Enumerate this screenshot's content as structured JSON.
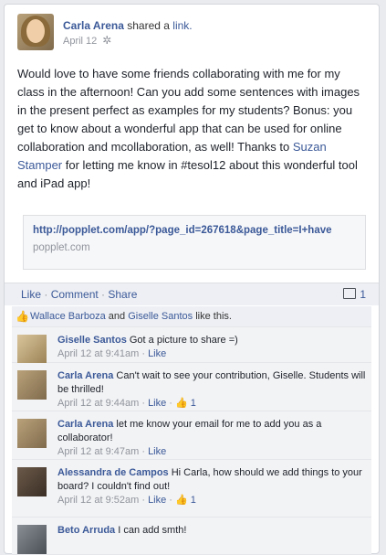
{
  "post": {
    "author": "Carla Arena",
    "action": " shared a ",
    "action_link": "link.",
    "date": "April 12",
    "body_part1": "Would love to have some friends collaborating with me for my class in the afternoon! Can you add some sentences with images in the present perfect as examples for my students? Bonus: you get to know about a wonderful app that can be used for online collaboration and mcollaboration, as well! Thanks to ",
    "body_mention": "Suzan Stamper",
    "body_part2": " for letting me know in #tesol12 about this wonderful tool and iPad app!",
    "link_url": "http://popplet.com/app/?page_id=267618&page_title=I+have",
    "link_domain": "popplet.com"
  },
  "actions": {
    "like": "Like",
    "comment": "Comment",
    "share": "Share",
    "comment_count": "1"
  },
  "likes": {
    "person1": "Wallace Barboza",
    "and": " and ",
    "person2": "Giselle Santos",
    "suffix": " like this."
  },
  "comments": [
    {
      "author": "Giselle Santos",
      "text": " Got a picture to share =)",
      "time": "April 12 at 9:41am",
      "like": "Like",
      "likes": ""
    },
    {
      "author": "Carla Arena",
      "text": " Can't wait to see your contribution, Giselle. Students will be thrilled!",
      "time": "April 12 at 9:44am",
      "like": "Like",
      "likes": "1"
    },
    {
      "author": "Carla Arena",
      "text": " let me know your email for me to add you as a collaborator!",
      "time": "April 12 at 9:47am",
      "like": "Like",
      "likes": ""
    },
    {
      "author": "Alessandra de Campos",
      "text": " Hi Carla, how should we add things to your board? I couldn't find out!",
      "time": "April 12 at 9:52am",
      "like": "Like",
      "likes": "1"
    },
    {
      "author": "Beto Arruda",
      "text": " I can add smth!",
      "time": "",
      "like": "",
      "likes": ""
    }
  ],
  "icons": {
    "gear": "gear-icon",
    "thumb": "thumbs-up-icon",
    "comment": "comment-icon"
  },
  "colors": {
    "link": "#3b5998",
    "meta": "#90949c"
  }
}
